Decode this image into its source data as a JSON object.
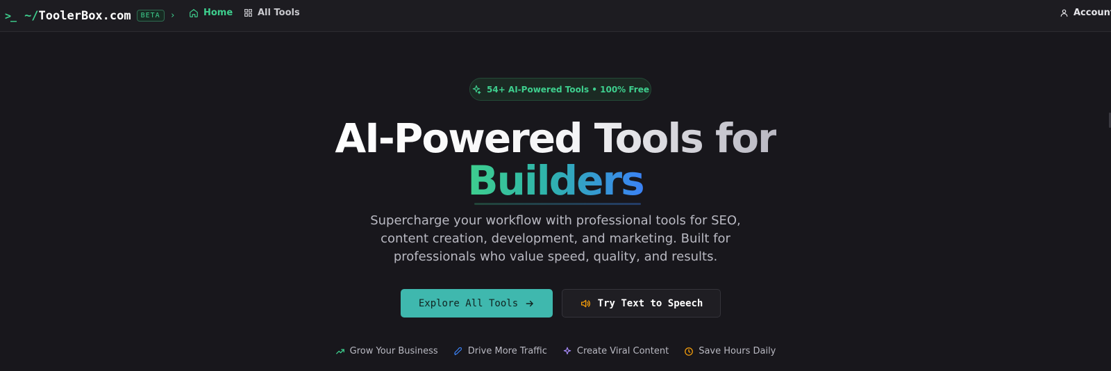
{
  "nav": {
    "prompt": ">_",
    "brand_tilde": "~/",
    "brand_name": "ToolerBox.com",
    "beta": "BETA",
    "chevron": "›",
    "home": "Home",
    "all_tools": "All Tools",
    "account": "Account"
  },
  "hero": {
    "badge": "54+ AI-Powered Tools • 100% Free",
    "title_line1": "AI-Powered Tools for",
    "title_line2": "Builders",
    "lede": "Supercharge your workflow with professional tools for SEO, content creation, development, and marketing. Built for professionals who value speed, quality, and results.",
    "primary_button": "Explore All Tools",
    "secondary_button": "Try Text to Speech"
  },
  "features": [
    {
      "label": "Grow Your Business",
      "icon": "trending-up-icon",
      "color": "#3ecf8e"
    },
    {
      "label": "Drive More Traffic",
      "icon": "rocket-icon",
      "color": "#3b82f6"
    },
    {
      "label": "Create Viral Content",
      "icon": "sparkle-icon",
      "color": "#a78bfa"
    },
    {
      "label": "Save Hours Daily",
      "icon": "clock-icon",
      "color": "#f59e0b"
    }
  ],
  "colors": {
    "accent": "#3ecf8e",
    "primary_button": "#3fb8ae",
    "background": "#18171c"
  }
}
